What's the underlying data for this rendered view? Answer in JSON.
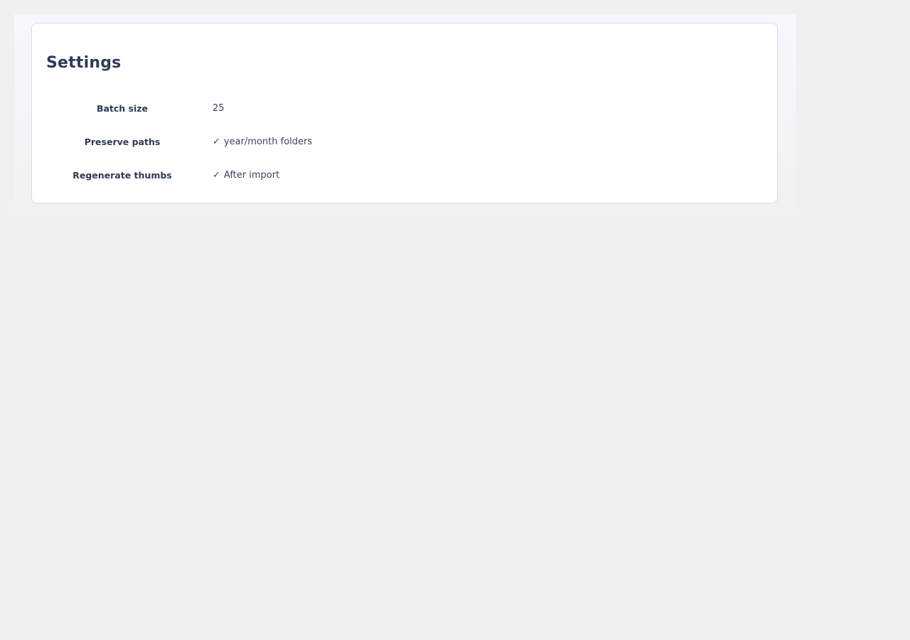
{
  "settings": {
    "title": "Settings",
    "rows": [
      {
        "label": "Batch size",
        "value": "25",
        "checked": false
      },
      {
        "label": "Preserve paths",
        "value": "year/month folders",
        "checked": true
      },
      {
        "label": "Regenerate thumbs",
        "value": "After import",
        "checked": true
      }
    ],
    "check_icon": "check-icon",
    "check_glyph": "✓"
  }
}
